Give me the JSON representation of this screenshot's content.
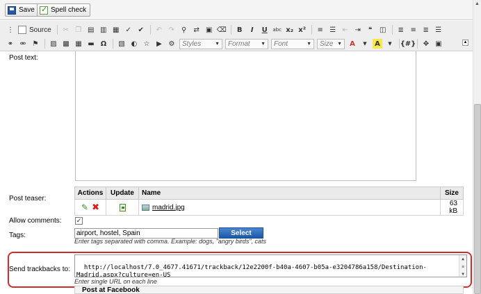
{
  "topbar": {
    "save_label": "Save",
    "spell_label": "Spell check"
  },
  "toolbar": {
    "source_label": "Source",
    "styles_placeholder": "Styles",
    "format_placeholder": "Format",
    "font_placeholder": "Font",
    "size_placeholder": "Size"
  },
  "form": {
    "post_text_label": "Post text:",
    "post_teaser_label": "Post teaser:",
    "allow_comments_label": "Allow comments:",
    "tags_label": "Tags:",
    "trackbacks_label": "Send trackbacks to:"
  },
  "attachments": {
    "columns": [
      "Actions",
      "Update",
      "Name",
      "Size"
    ],
    "rows": [
      {
        "name": "madrid.jpg",
        "size": "63 kB"
      }
    ]
  },
  "allow_comments": {
    "checked": true,
    "mark": "✓"
  },
  "tags": {
    "value": "airport, hostel, Spain",
    "select_label": "Select",
    "hint": "Enter tags separated with comma. Example: dogs, \"angry birds\", cats"
  },
  "trackbacks": {
    "value": "http://localhost/7.0_4677.41671/trackback/12e2200f-b40a-4607-b05a-e3204786a158/Destination-Madrid.aspx?culture=en-US",
    "hint": "Enter single URL on each line"
  },
  "facebook": {
    "header": "Post at Facebook"
  },
  "colors": {
    "highlight": "#d22b2b",
    "select_button": "#1a57a6"
  }
}
